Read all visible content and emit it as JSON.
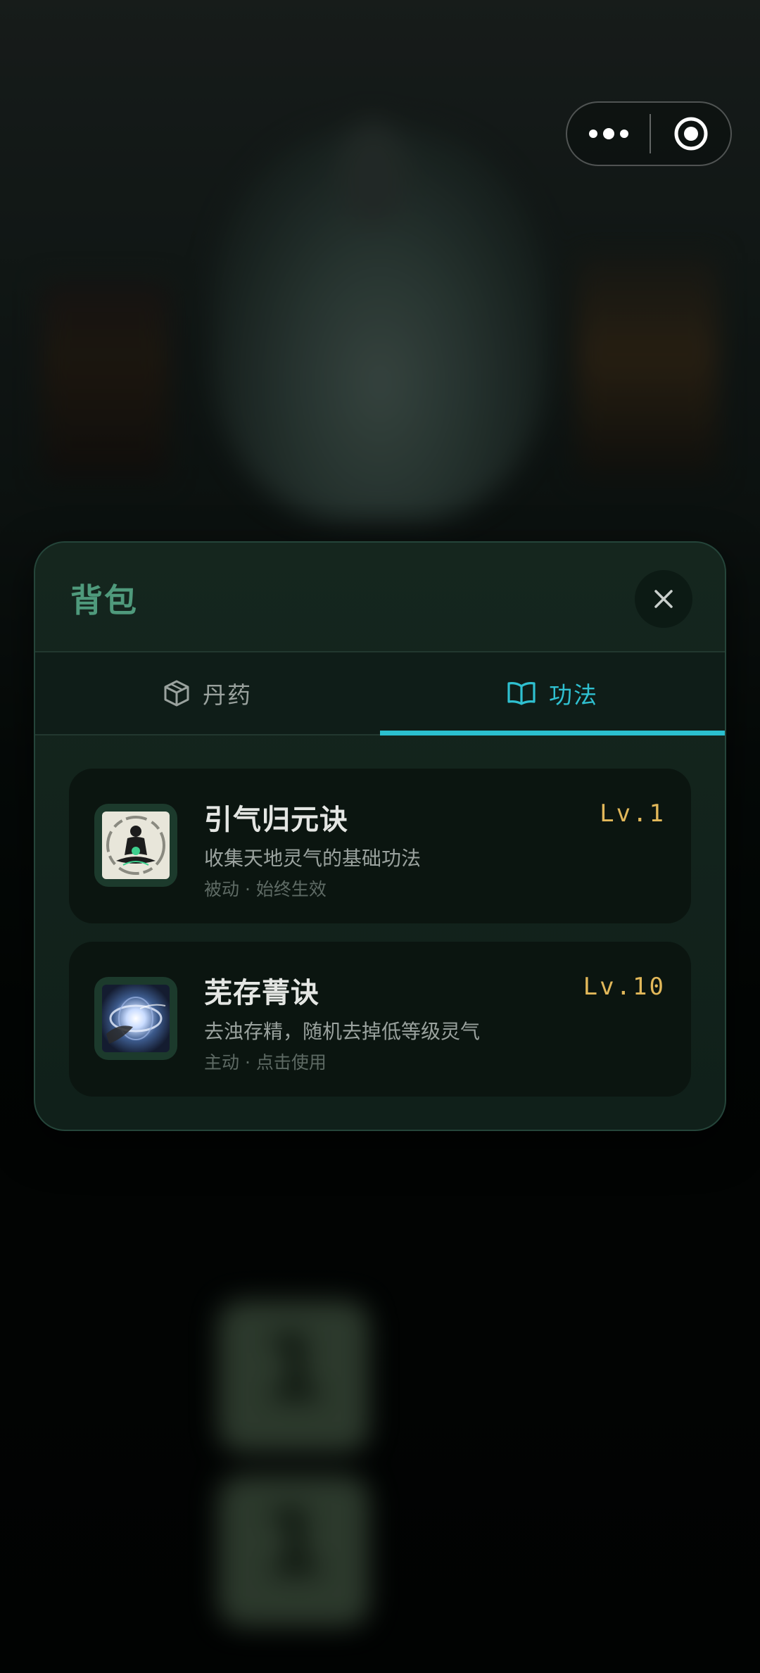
{
  "capsule": {
    "more_icon": "more-dots-icon",
    "close_icon": "record-target-icon"
  },
  "background_tiles": [
    "1",
    "1"
  ],
  "panel": {
    "title": "背包",
    "close_icon": "close-x-icon"
  },
  "tabs": [
    {
      "label": "丹药",
      "icon": "box-icon",
      "active": false
    },
    {
      "label": "功法",
      "icon": "book-icon",
      "active": true
    }
  ],
  "skills": [
    {
      "name": "引气归元诀",
      "level": "Lv.1",
      "description": "收集天地灵气的基础功法",
      "meta": "被动 · 始终生效",
      "icon": "meditating-figure-icon"
    },
    {
      "name": "芜存菁诀",
      "level": "Lv.10",
      "description": "去浊存精，随机去掉低等级灵气",
      "meta": "主动 · 点击使用",
      "icon": "vortex-icon"
    }
  ],
  "colors": {
    "accent": "#2bc0cf",
    "title": "#4f9a7c",
    "level": "#e2b85a"
  }
}
